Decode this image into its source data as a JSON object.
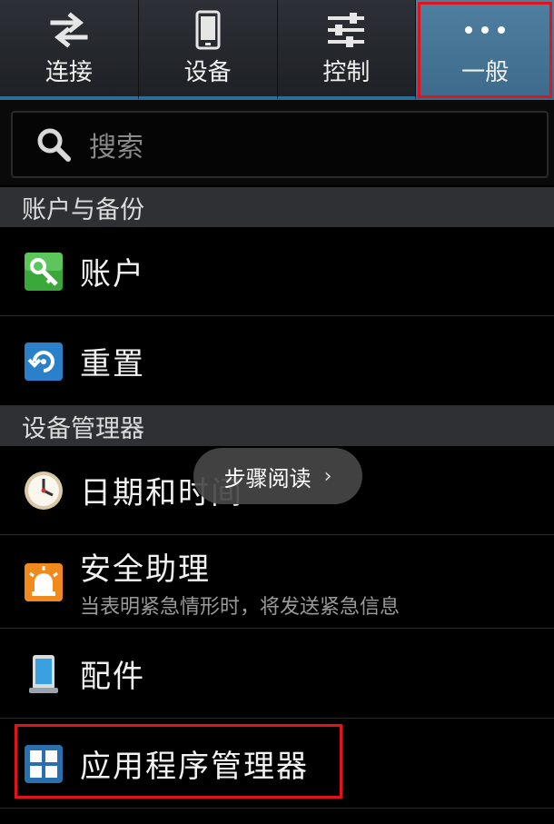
{
  "tabs": [
    {
      "label": "连接",
      "icon": "swap-arrows-icon"
    },
    {
      "label": "设备",
      "icon": "phone-icon"
    },
    {
      "label": "控制",
      "icon": "sliders-icon"
    },
    {
      "label": "一般",
      "icon": "more-dots-icon",
      "selected": true
    }
  ],
  "search": {
    "placeholder": "搜索",
    "icon": "search-icon"
  },
  "sections": [
    {
      "title": "账户与备份"
    },
    {
      "title": "设备管理器"
    }
  ],
  "items": [
    {
      "title": "账户",
      "icon": "key-icon"
    },
    {
      "title": "重置",
      "icon": "reset-icon"
    },
    {
      "title": "日期和时间",
      "icon": "clock-icon"
    },
    {
      "title": "安全助理",
      "subtitle": "当表明紧急情形时，将发送紧急信息",
      "icon": "alarm-icon"
    },
    {
      "title": "配件",
      "icon": "accessory-icon"
    },
    {
      "title": "应用程序管理器",
      "icon": "apps-grid-icon"
    }
  ],
  "overlay": {
    "label": "步骤阅读",
    "chevron": "›"
  },
  "colors": {
    "accent": "#3e6b8c",
    "highlight": "#e0141b",
    "section_bg": "#2e3034"
  }
}
